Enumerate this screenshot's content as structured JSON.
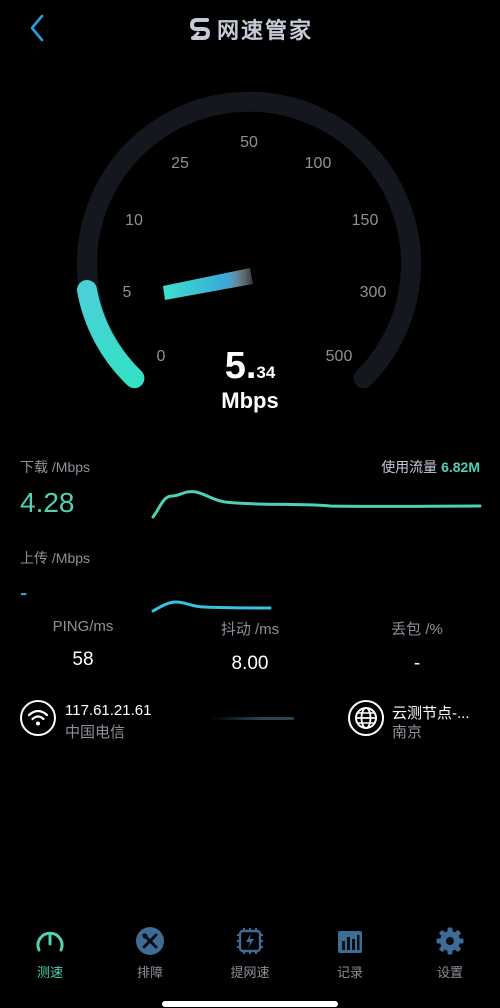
{
  "header": {
    "title": "网速管家",
    "logo_icon": "speed-logo-icon",
    "back_icon": "chevron-left-icon"
  },
  "gauge": {
    "ticks": [
      "0",
      "5",
      "10",
      "25",
      "50",
      "100",
      "150",
      "300",
      "500"
    ],
    "speed_integer": "5.",
    "speed_decimal": "34",
    "unit": "Mbps",
    "progress_fraction": 0.18,
    "accent_color": "#3fdcc4"
  },
  "download": {
    "label": "下载 /Mbps",
    "value": "4.28",
    "color": "#4fd1b3"
  },
  "upload": {
    "label": "上传 /Mbps",
    "value": "-",
    "color": "#37c3e0"
  },
  "data_usage": {
    "label": "使用流量",
    "value": "6.82M"
  },
  "metrics": [
    {
      "label": "PING/ms",
      "value": "58"
    },
    {
      "label": "抖动 /ms",
      "value": "8.00"
    },
    {
      "label": "丢包 /%",
      "value": "-"
    }
  ],
  "network": {
    "ip": "117.61.21.61",
    "isp": "中国电信",
    "node": "云测节点-...",
    "city": "南京"
  },
  "tabs": [
    {
      "label": "测速",
      "icon": "speedometer-icon",
      "active": true
    },
    {
      "label": "排障",
      "icon": "tools-icon",
      "active": false
    },
    {
      "label": "提网速",
      "icon": "chip-boost-icon",
      "active": false
    },
    {
      "label": "记录",
      "icon": "bar-chart-icon",
      "active": false
    },
    {
      "label": "设置",
      "icon": "gear-icon",
      "active": false
    }
  ]
}
